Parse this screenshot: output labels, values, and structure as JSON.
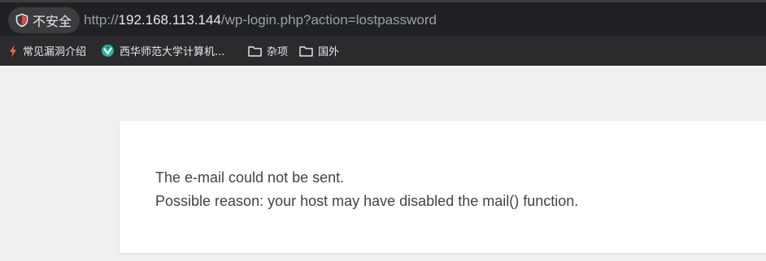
{
  "browser": {
    "security_label": "不安全",
    "url": {
      "scheme": "http://",
      "host": "192.168.113.144",
      "path": "/wp-login.php?action=lostpassword"
    }
  },
  "bookmarks": [
    {
      "label": "常见漏洞介绍",
      "icon": "flame-icon"
    },
    {
      "label": "西华师范大学计算机...",
      "icon": "site-logo-icon"
    },
    {
      "label": "杂项",
      "icon": "folder-icon"
    },
    {
      "label": "国外",
      "icon": "folder-icon"
    }
  ],
  "page": {
    "error_line_1": "The e-mail could not be sent.",
    "error_line_2": "Possible reason: your host may have disabled the mail() function."
  },
  "colors": {
    "chrome_bg": "#202124",
    "bookmarks_bg": "#2b2b2e",
    "page_bg": "#f0f0f1",
    "card_bg": "#ffffff",
    "text": "#3c434a",
    "warning_red": "#e8453c"
  }
}
